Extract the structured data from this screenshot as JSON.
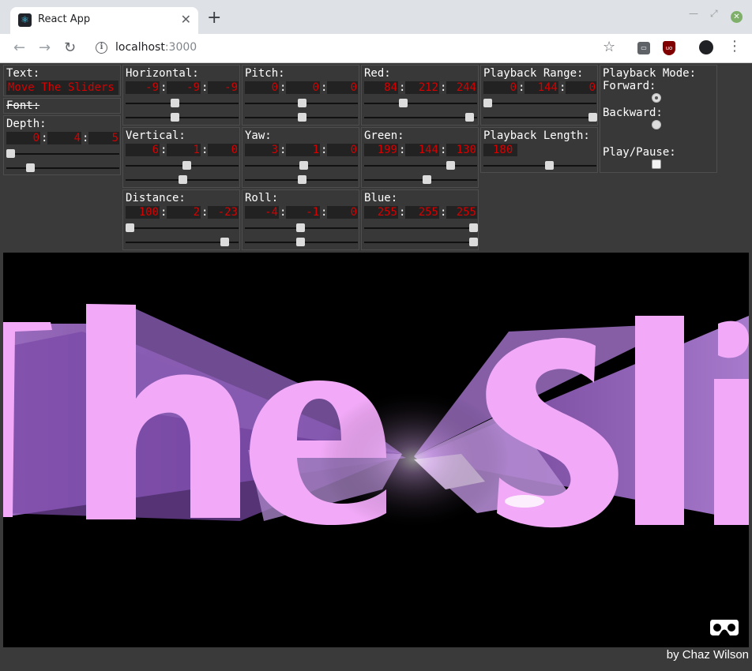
{
  "browser": {
    "tab_title": "React App",
    "tab_close": "✕",
    "new_tab": "+",
    "url_host": "localhost",
    "url_port": ":3000",
    "icons": [
      "react-favicon",
      "back-arrow-icon",
      "forward-arrow-icon",
      "reload-icon",
      "info-icon",
      "star-icon",
      "extension-icon",
      "ublock-icon",
      "account-icon",
      "menu-dots-icon"
    ]
  },
  "controls": {
    "text": {
      "label": "Text:",
      "value": "Move The Sliders"
    },
    "font": {
      "label": "Font:"
    },
    "depth": {
      "label": "Depth:",
      "values": [
        "0",
        "4",
        "5"
      ],
      "sliders": [
        0.0,
        0.19
      ]
    },
    "horizontal": {
      "label": "Horizontal:",
      "values": [
        "-9",
        "-9",
        "-9"
      ],
      "sliders": [
        0.43,
        0.43
      ]
    },
    "vertical": {
      "label": "Vertical:",
      "values": [
        "6",
        "1",
        "0"
      ],
      "sliders": [
        0.54,
        0.5
      ]
    },
    "distance": {
      "label": "Distance:",
      "values": [
        "100",
        "2",
        "-23"
      ],
      "sliders": [
        0.0,
        0.9
      ]
    },
    "pitch": {
      "label": "Pitch:",
      "values": [
        "0",
        "0",
        "0"
      ],
      "sliders": [
        0.5,
        0.5
      ]
    },
    "yaw": {
      "label": "Yaw:",
      "values": [
        "3",
        "1",
        "0"
      ],
      "sliders": [
        0.52,
        0.5
      ]
    },
    "roll": {
      "label": "Roll:",
      "values": [
        "-4",
        "-1",
        "0"
      ],
      "sliders": [
        0.49,
        0.49
      ]
    },
    "red": {
      "label": "Red:",
      "values": [
        "84",
        "212",
        "244"
      ],
      "sliders": [
        0.33,
        0.96
      ]
    },
    "green": {
      "label": "Green:",
      "values": [
        "199",
        "144",
        "130"
      ],
      "sliders": [
        0.78,
        0.56
      ]
    },
    "blue": {
      "label": "Blue:",
      "values": [
        "255",
        "255",
        "255"
      ],
      "sliders": [
        1.0,
        1.0
      ]
    },
    "playback_range": {
      "label": "Playback Range:",
      "values": [
        "0",
        "144",
        "0"
      ],
      "sliders": [
        0.0,
        1.0
      ]
    },
    "playback_length": {
      "label": "Playback Length:",
      "value": "180",
      "slider": 0.59
    },
    "playback_mode": {
      "label": "Playback Mode:",
      "forward": "Forward:",
      "backward": "Backward:",
      "selected": "forward"
    },
    "play_pause": {
      "label": "Play/Pause:",
      "checked": false
    }
  },
  "scene": {
    "text_visible": "he Sl",
    "text_color": "#e8a2f0",
    "background": "#000000",
    "vr_icon": "vr-headset-icon"
  },
  "footer": {
    "credit": "by Chaz Wilson"
  },
  "colors": {
    "number_text": "#d60000",
    "panel_bg": "#3a3a3a",
    "field_bg": "#222222"
  }
}
